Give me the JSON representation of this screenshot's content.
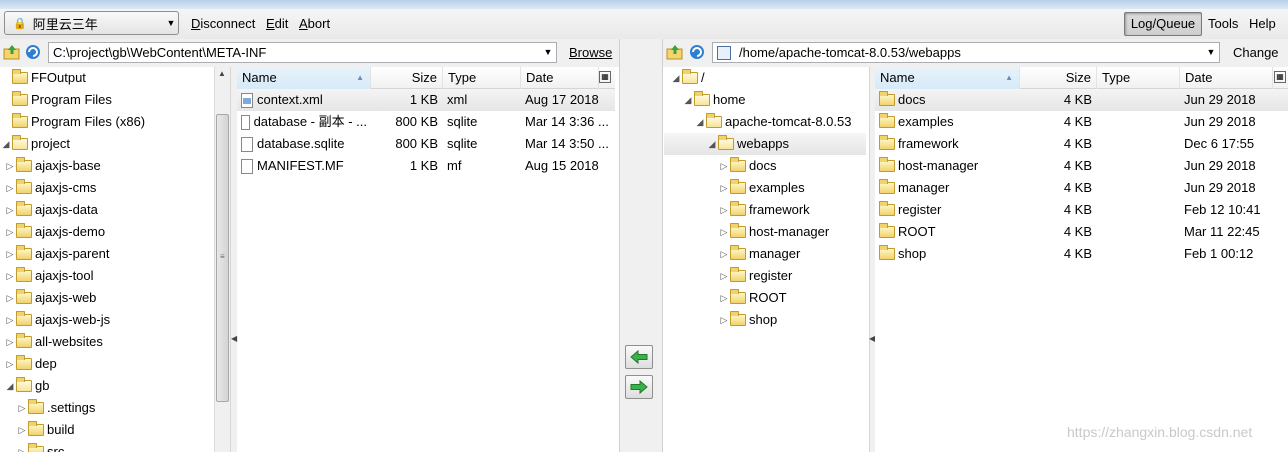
{
  "toolbar": {
    "site": "阿里云三年",
    "menu": [
      {
        "key": "D",
        "rest": "isconnect"
      },
      {
        "key": "E",
        "rest": "dit"
      },
      {
        "key": "A",
        "rest": "bort"
      }
    ],
    "log_queue": "Log/Queue",
    "tools": "Tools",
    "help": "Help"
  },
  "local": {
    "path": "C:\\project\\gb\\WebContent\\META-INF",
    "browse": "Browse",
    "tree": [
      {
        "label": "FFOutput",
        "indent": 0,
        "exp": ""
      },
      {
        "label": "Program Files",
        "indent": 0,
        "exp": ""
      },
      {
        "label": "Program Files (x86)",
        "indent": 0,
        "exp": ""
      },
      {
        "label": "project",
        "indent": 0,
        "exp": "open"
      },
      {
        "label": "ajaxjs-base",
        "indent": 1,
        "exp": "closed"
      },
      {
        "label": "ajaxjs-cms",
        "indent": 1,
        "exp": "closed"
      },
      {
        "label": "ajaxjs-data",
        "indent": 1,
        "exp": "closed"
      },
      {
        "label": "ajaxjs-demo",
        "indent": 1,
        "exp": "closed"
      },
      {
        "label": "ajaxjs-parent",
        "indent": 1,
        "exp": "closed"
      },
      {
        "label": "ajaxjs-tool",
        "indent": 1,
        "exp": "closed"
      },
      {
        "label": "ajaxjs-web",
        "indent": 1,
        "exp": "closed"
      },
      {
        "label": "ajaxjs-web-js",
        "indent": 1,
        "exp": "closed"
      },
      {
        "label": "all-websites",
        "indent": 1,
        "exp": "closed"
      },
      {
        "label": "dep",
        "indent": 1,
        "exp": "closed"
      },
      {
        "label": "gb",
        "indent": 1,
        "exp": "open"
      },
      {
        "label": ".settings",
        "indent": 2,
        "exp": "closed"
      },
      {
        "label": "build",
        "indent": 2,
        "exp": "closed"
      },
      {
        "label": "src",
        "indent": 2,
        "exp": "closed"
      }
    ],
    "columns": {
      "name": "Name",
      "size": "Size",
      "type": "Type",
      "date": "Date"
    },
    "files": [
      {
        "name": "context.xml",
        "size": "1 KB",
        "type": "xml",
        "date": "Aug 17 2018",
        "icon": "xml-file-icon"
      },
      {
        "name": "database - 副本 - ...",
        "size": "800 KB",
        "type": "sqlite",
        "date": "Mar 14 3:36 ...",
        "icon": "file-icon"
      },
      {
        "name": "database.sqlite",
        "size": "800 KB",
        "type": "sqlite",
        "date": "Mar 14 3:50 ...",
        "icon": "file-icon"
      },
      {
        "name": "MANIFEST.MF",
        "size": "1 KB",
        "type": "mf",
        "date": "Aug 15 2018",
        "icon": "file-icon"
      }
    ]
  },
  "remote": {
    "path": "/home/apache-tomcat-8.0.53/webapps",
    "change": "Change",
    "tree": [
      {
        "label": "/",
        "indent": 0,
        "exp": "open"
      },
      {
        "label": "home",
        "indent": 1,
        "exp": "open"
      },
      {
        "label": "apache-tomcat-8.0.53",
        "indent": 2,
        "exp": "open"
      },
      {
        "label": "webapps",
        "indent": 3,
        "exp": "open"
      },
      {
        "label": "docs",
        "indent": 4,
        "exp": "closed"
      },
      {
        "label": "examples",
        "indent": 4,
        "exp": "closed"
      },
      {
        "label": "framework",
        "indent": 4,
        "exp": "closed"
      },
      {
        "label": "host-manager",
        "indent": 4,
        "exp": "closed"
      },
      {
        "label": "manager",
        "indent": 4,
        "exp": "closed"
      },
      {
        "label": "register",
        "indent": 4,
        "exp": "closed"
      },
      {
        "label": "ROOT",
        "indent": 4,
        "exp": "closed"
      },
      {
        "label": "shop",
        "indent": 4,
        "exp": "closed"
      }
    ],
    "columns": {
      "name": "Name",
      "size": "Size",
      "type": "Type",
      "date": "Date"
    },
    "files": [
      {
        "name": "docs",
        "size": "4 KB",
        "type": "",
        "date": "Jun 29 2018"
      },
      {
        "name": "examples",
        "size": "4 KB",
        "type": "",
        "date": "Jun 29 2018"
      },
      {
        "name": "framework",
        "size": "4 KB",
        "type": "",
        "date": "Dec 6 17:55"
      },
      {
        "name": "host-manager",
        "size": "4 KB",
        "type": "",
        "date": "Jun 29 2018"
      },
      {
        "name": "manager",
        "size": "4 KB",
        "type": "",
        "date": "Jun 29 2018"
      },
      {
        "name": "register",
        "size": "4 KB",
        "type": "",
        "date": "Feb 12 10:41"
      },
      {
        "name": "ROOT",
        "size": "4 KB",
        "type": "",
        "date": "Mar 11 22:45"
      },
      {
        "name": "shop",
        "size": "4 KB",
        "type": "",
        "date": "Feb 1 00:12"
      }
    ]
  },
  "watermark": "https://zhangxin.blog.csdn.net"
}
